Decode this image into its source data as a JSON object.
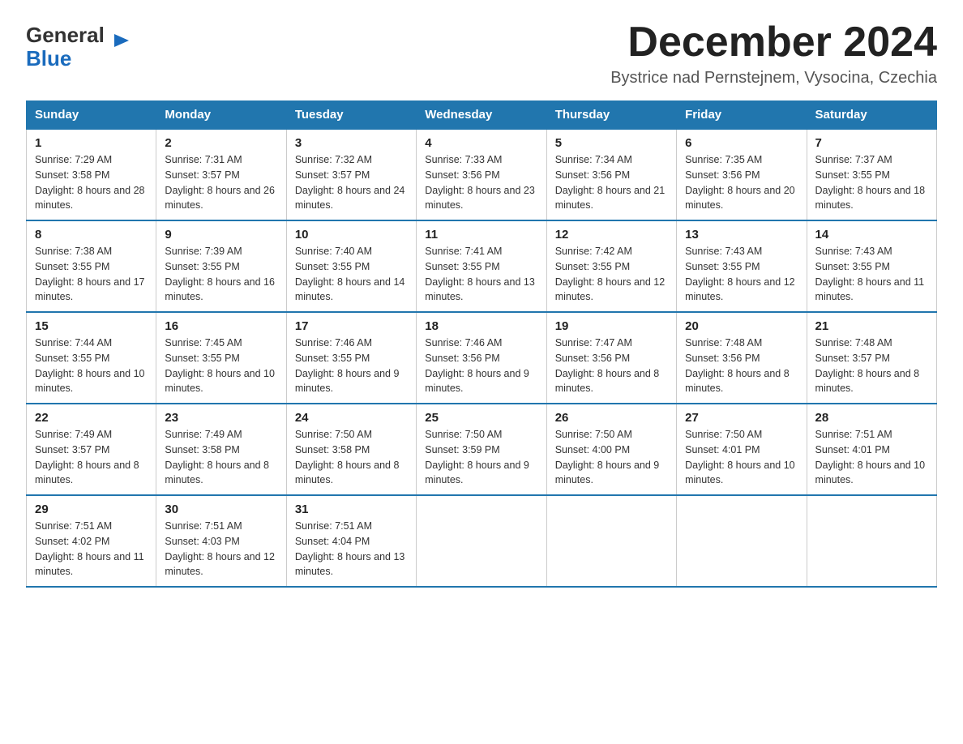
{
  "header": {
    "logo_general": "General",
    "logo_blue": "Blue",
    "title": "December 2024",
    "location": "Bystrice nad Pernstejnem, Vysocina, Czechia"
  },
  "days_of_week": [
    "Sunday",
    "Monday",
    "Tuesday",
    "Wednesday",
    "Thursday",
    "Friday",
    "Saturday"
  ],
  "weeks": [
    [
      {
        "day": "1",
        "sunrise": "7:29 AM",
        "sunset": "3:58 PM",
        "daylight": "8 hours and 28 minutes."
      },
      {
        "day": "2",
        "sunrise": "7:31 AM",
        "sunset": "3:57 PM",
        "daylight": "8 hours and 26 minutes."
      },
      {
        "day": "3",
        "sunrise": "7:32 AM",
        "sunset": "3:57 PM",
        "daylight": "8 hours and 24 minutes."
      },
      {
        "day": "4",
        "sunrise": "7:33 AM",
        "sunset": "3:56 PM",
        "daylight": "8 hours and 23 minutes."
      },
      {
        "day": "5",
        "sunrise": "7:34 AM",
        "sunset": "3:56 PM",
        "daylight": "8 hours and 21 minutes."
      },
      {
        "day": "6",
        "sunrise": "7:35 AM",
        "sunset": "3:56 PM",
        "daylight": "8 hours and 20 minutes."
      },
      {
        "day": "7",
        "sunrise": "7:37 AM",
        "sunset": "3:55 PM",
        "daylight": "8 hours and 18 minutes."
      }
    ],
    [
      {
        "day": "8",
        "sunrise": "7:38 AM",
        "sunset": "3:55 PM",
        "daylight": "8 hours and 17 minutes."
      },
      {
        "day": "9",
        "sunrise": "7:39 AM",
        "sunset": "3:55 PM",
        "daylight": "8 hours and 16 minutes."
      },
      {
        "day": "10",
        "sunrise": "7:40 AM",
        "sunset": "3:55 PM",
        "daylight": "8 hours and 14 minutes."
      },
      {
        "day": "11",
        "sunrise": "7:41 AM",
        "sunset": "3:55 PM",
        "daylight": "8 hours and 13 minutes."
      },
      {
        "day": "12",
        "sunrise": "7:42 AM",
        "sunset": "3:55 PM",
        "daylight": "8 hours and 12 minutes."
      },
      {
        "day": "13",
        "sunrise": "7:43 AM",
        "sunset": "3:55 PM",
        "daylight": "8 hours and 12 minutes."
      },
      {
        "day": "14",
        "sunrise": "7:43 AM",
        "sunset": "3:55 PM",
        "daylight": "8 hours and 11 minutes."
      }
    ],
    [
      {
        "day": "15",
        "sunrise": "7:44 AM",
        "sunset": "3:55 PM",
        "daylight": "8 hours and 10 minutes."
      },
      {
        "day": "16",
        "sunrise": "7:45 AM",
        "sunset": "3:55 PM",
        "daylight": "8 hours and 10 minutes."
      },
      {
        "day": "17",
        "sunrise": "7:46 AM",
        "sunset": "3:55 PM",
        "daylight": "8 hours and 9 minutes."
      },
      {
        "day": "18",
        "sunrise": "7:46 AM",
        "sunset": "3:56 PM",
        "daylight": "8 hours and 9 minutes."
      },
      {
        "day": "19",
        "sunrise": "7:47 AM",
        "sunset": "3:56 PM",
        "daylight": "8 hours and 8 minutes."
      },
      {
        "day": "20",
        "sunrise": "7:48 AM",
        "sunset": "3:56 PM",
        "daylight": "8 hours and 8 minutes."
      },
      {
        "day": "21",
        "sunrise": "7:48 AM",
        "sunset": "3:57 PM",
        "daylight": "8 hours and 8 minutes."
      }
    ],
    [
      {
        "day": "22",
        "sunrise": "7:49 AM",
        "sunset": "3:57 PM",
        "daylight": "8 hours and 8 minutes."
      },
      {
        "day": "23",
        "sunrise": "7:49 AM",
        "sunset": "3:58 PM",
        "daylight": "8 hours and 8 minutes."
      },
      {
        "day": "24",
        "sunrise": "7:50 AM",
        "sunset": "3:58 PM",
        "daylight": "8 hours and 8 minutes."
      },
      {
        "day": "25",
        "sunrise": "7:50 AM",
        "sunset": "3:59 PM",
        "daylight": "8 hours and 9 minutes."
      },
      {
        "day": "26",
        "sunrise": "7:50 AM",
        "sunset": "4:00 PM",
        "daylight": "8 hours and 9 minutes."
      },
      {
        "day": "27",
        "sunrise": "7:50 AM",
        "sunset": "4:01 PM",
        "daylight": "8 hours and 10 minutes."
      },
      {
        "day": "28",
        "sunrise": "7:51 AM",
        "sunset": "4:01 PM",
        "daylight": "8 hours and 10 minutes."
      }
    ],
    [
      {
        "day": "29",
        "sunrise": "7:51 AM",
        "sunset": "4:02 PM",
        "daylight": "8 hours and 11 minutes."
      },
      {
        "day": "30",
        "sunrise": "7:51 AM",
        "sunset": "4:03 PM",
        "daylight": "8 hours and 12 minutes."
      },
      {
        "day": "31",
        "sunrise": "7:51 AM",
        "sunset": "4:04 PM",
        "daylight": "8 hours and 13 minutes."
      },
      null,
      null,
      null,
      null
    ]
  ],
  "labels": {
    "sunrise_prefix": "Sunrise: ",
    "sunset_prefix": "Sunset: ",
    "daylight_prefix": "Daylight: "
  }
}
